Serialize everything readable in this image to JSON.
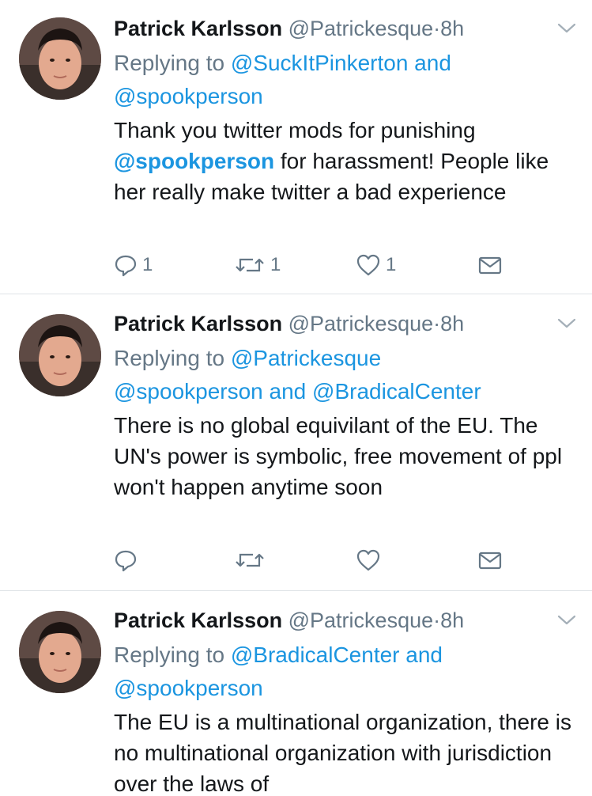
{
  "tweets": [
    {
      "name": "Patrick Karlsson",
      "handle": "@Patrickesque",
      "separator": "·",
      "time": "8h",
      "replying_prefix": "Replying to",
      "replying_line1_link": "@SuckItPinkerton and",
      "replying_line2_link": "@spookperson",
      "text_mention": "@spookperson",
      "text_before": "Thank you twitter mods for punishing",
      "text_after": "for harassment! People like her really make twitter a bad experience",
      "reply_count": "1",
      "retweet_count": "1",
      "like_count": "1"
    },
    {
      "name": "Patrick Karlsson",
      "handle": "@Patrickesque",
      "separator": "·",
      "time": "8h",
      "replying_prefix": "Replying to",
      "replying_line1_link": "@Patrickesque",
      "replying_line2_link": "@spookperson and @BradicalCenter",
      "text": "There is no global equivilant of the EU. The UN's power is symbolic, free movement of ppl won't happen anytime soon",
      "reply_count": "",
      "retweet_count": "",
      "like_count": ""
    },
    {
      "name": "Patrick Karlsson",
      "handle": "@Patrickesque",
      "separator": "·",
      "time": "8h",
      "replying_prefix": "Replying to",
      "replying_line1_link": "@BradicalCenter and",
      "replying_line2_link": "@spookperson",
      "text": "The EU is a multinational organization, there is no multinational organization with jurisdiction over the laws of"
    }
  ],
  "icons": {
    "reply": "speech-bubble-icon",
    "retweet": "retweet-arrows-icon",
    "like": "heart-icon",
    "dm": "envelope-icon",
    "menu": "chevron-down-icon"
  },
  "colors": {
    "link": "#1b95e0",
    "muted": "#657786",
    "text": "#14171a",
    "divider": "#dfe3e7"
  }
}
